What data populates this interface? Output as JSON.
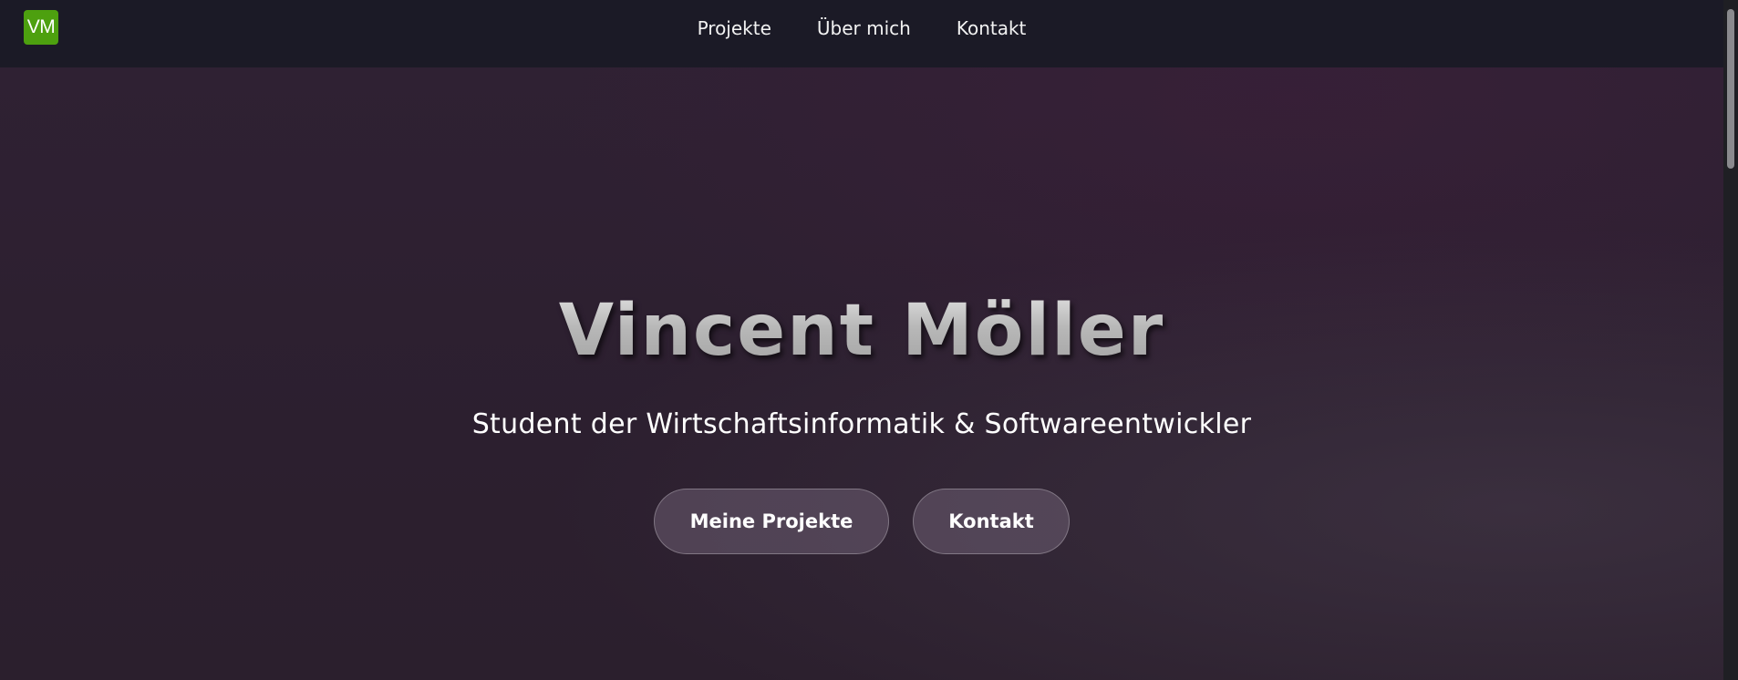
{
  "navbar": {
    "logo_text": "VM",
    "logo_color": "#4da00f",
    "links": [
      {
        "label": "Projekte"
      },
      {
        "label": "Über mich"
      },
      {
        "label": "Kontakt"
      }
    ]
  },
  "hero": {
    "title": "Vincent Möller",
    "subtitle": "Student der Wirtschaftsinformatik & Softwareentwickler",
    "buttons": {
      "projects_label": "Meine Projekte",
      "contact_label": "Kontakt"
    }
  },
  "colors": {
    "navbar_bg": "#1b1a26",
    "hero_bg": "#2c1f2f",
    "text": "#ffffff"
  }
}
